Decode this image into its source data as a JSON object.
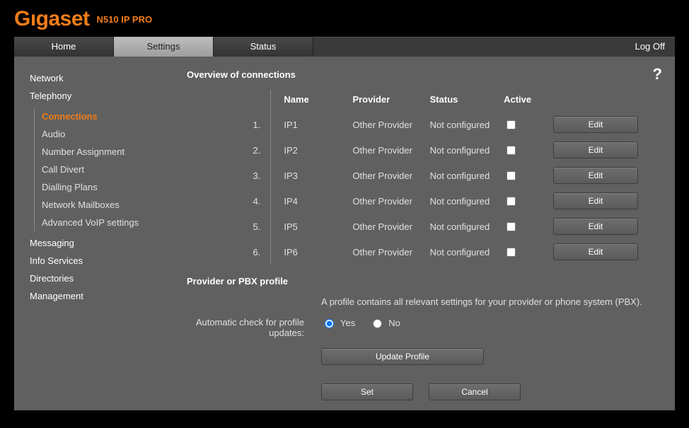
{
  "brand": "Gıgaset",
  "product": "N510 IP PRO",
  "tabs": {
    "home": "Home",
    "settings": "Settings",
    "status": "Status"
  },
  "logoff": "Log Off",
  "help": "?",
  "sidebar": {
    "items": [
      "Network",
      "Telephony",
      "Messaging",
      "Info Services",
      "Directories",
      "Management"
    ],
    "telephony_sub": [
      "Connections",
      "Audio",
      "Number Assignment",
      "Call Divert",
      "Dialling Plans",
      "Network Mailboxes",
      "Advanced VoIP settings"
    ]
  },
  "overview": {
    "title": "Overview of connections",
    "headers": {
      "name": "Name",
      "provider": "Provider",
      "status": "Status",
      "active": "Active"
    },
    "edit_label": "Edit",
    "rows": [
      {
        "num": "1.",
        "name": "IP1",
        "provider": "Other Provider",
        "status": "Not configured"
      },
      {
        "num": "2.",
        "name": "IP2",
        "provider": "Other Provider",
        "status": "Not configured"
      },
      {
        "num": "3.",
        "name": "IP3",
        "provider": "Other Provider",
        "status": "Not configured"
      },
      {
        "num": "4.",
        "name": "IP4",
        "provider": "Other Provider",
        "status": "Not configured"
      },
      {
        "num": "5.",
        "name": "IP5",
        "provider": "Other Provider",
        "status": "Not configured"
      },
      {
        "num": "6.",
        "name": "IP6",
        "provider": "Other Provider",
        "status": "Not configured"
      }
    ]
  },
  "profile": {
    "title": "Provider or PBX profile",
    "hint": "A profile contains all relevant settings for your provider or phone system (PBX).",
    "auto_label": "Automatic check for profile updates:",
    "yes": "Yes",
    "no": "No",
    "update_btn": "Update Profile",
    "set_btn": "Set",
    "cancel_btn": "Cancel"
  }
}
